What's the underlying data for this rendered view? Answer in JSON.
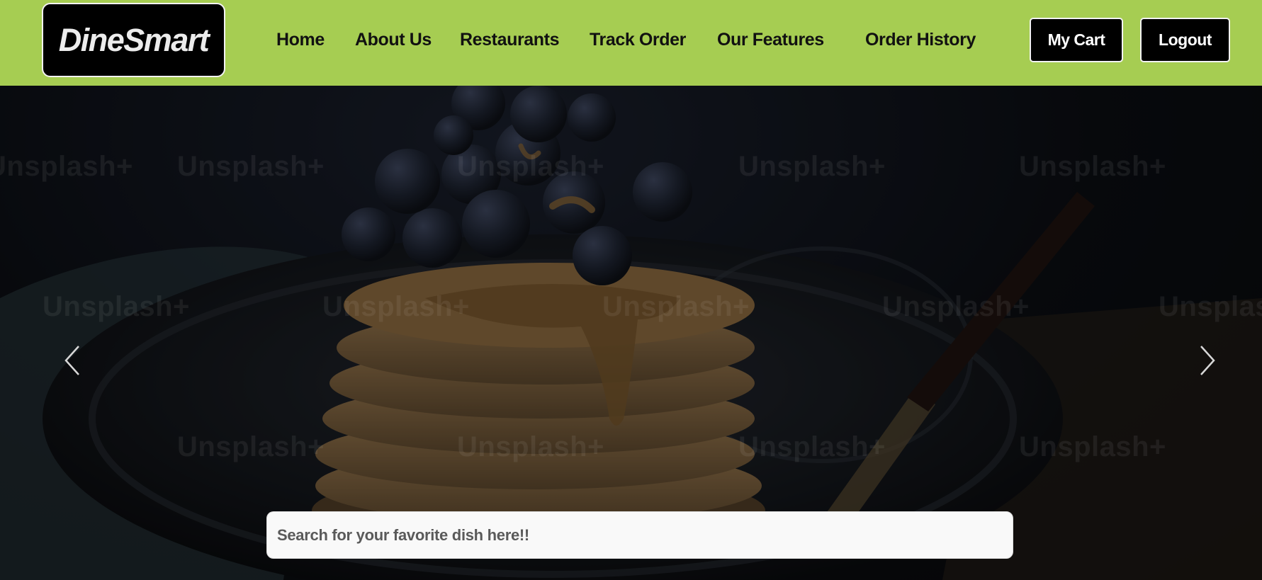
{
  "brand": {
    "logo_text": "DineSmart"
  },
  "nav": {
    "links": [
      "Home",
      "About Us",
      "Restaurants",
      "Track Order",
      "Our Features",
      "Order History"
    ],
    "cart_label": "My Cart",
    "logout_label": "Logout"
  },
  "hero": {
    "watermark_text": "Unsplash+",
    "image_subject": "stack of pancakes with blueberries and caramel sauce in a dark bowl",
    "prev_icon": "chevron-left-icon",
    "next_icon": "chevron-right-icon"
  },
  "search": {
    "placeholder": "Search for your favorite dish here!!",
    "value": ""
  },
  "colors": {
    "navbar_bg": "#a6cd52",
    "button_bg": "#000000",
    "button_text": "#ffffff"
  }
}
